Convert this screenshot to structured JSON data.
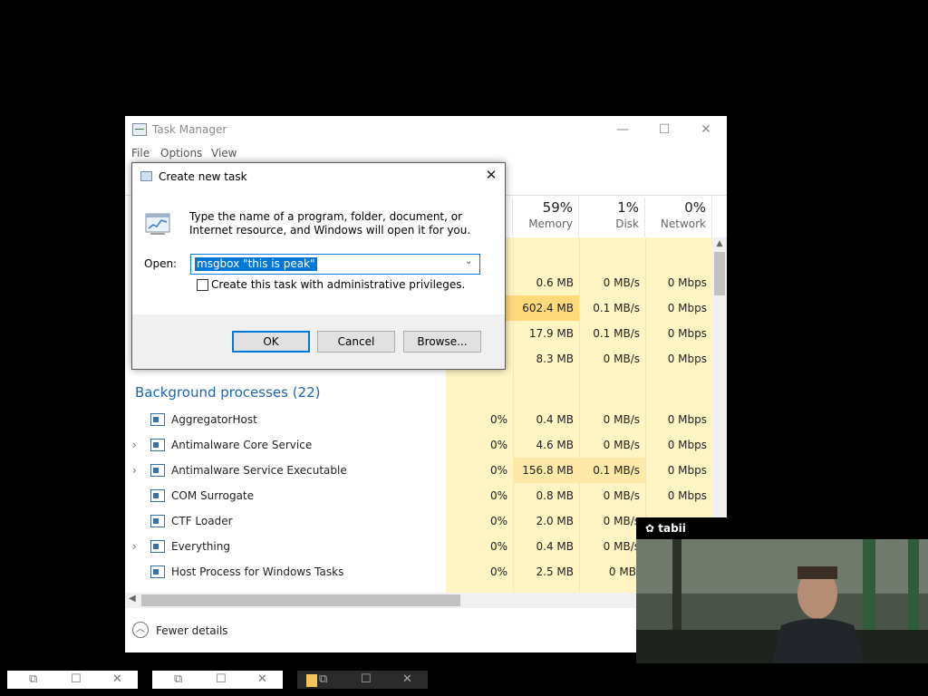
{
  "task_manager": {
    "title": "Task Manager",
    "menu": [
      "File",
      "Options",
      "View"
    ],
    "columns": [
      {
        "pct": "59%",
        "label": "Memory"
      },
      {
        "pct": "1%",
        "label": "Disk"
      },
      {
        "pct": "0%",
        "label": "Network"
      }
    ],
    "app_rows": [
      {
        "memory": "0.6 MB",
        "disk": "0 MB/s",
        "network": "0 Mbps"
      },
      {
        "memory": "602.4 MB",
        "disk": "0.1 MB/s",
        "network": "0 Mbps"
      },
      {
        "memory": "17.9 MB",
        "disk": "0.1 MB/s",
        "network": "0 Mbps"
      },
      {
        "memory": "8.3 MB",
        "disk": "0 MB/s",
        "network": "0 Mbps"
      }
    ],
    "background_title": "Background processes (22)",
    "processes": [
      {
        "name": "AggregatorHost",
        "cpu": "0%",
        "memory": "0.4 MB",
        "disk": "0 MB/s",
        "network": "0 Mbps",
        "expandable": false
      },
      {
        "name": "Antimalware Core Service",
        "cpu": "0%",
        "memory": "4.6 MB",
        "disk": "0 MB/s",
        "network": "0 Mbps",
        "expandable": true
      },
      {
        "name": "Antimalware Service Executable",
        "cpu": "0%",
        "memory": "156.8 MB",
        "disk": "0.1 MB/s",
        "network": "0 Mbps",
        "expandable": true
      },
      {
        "name": "COM Surrogate",
        "cpu": "0%",
        "memory": "0.8 MB",
        "disk": "0 MB/s",
        "network": "0 Mbps",
        "expandable": false
      },
      {
        "name": "CTF Loader",
        "cpu": "0%",
        "memory": "2.0 MB",
        "disk": "0 MB/s",
        "network": "",
        "expandable": false
      },
      {
        "name": "Everything",
        "cpu": "0%",
        "memory": "0.4 MB",
        "disk": "0 MB/s",
        "network": "",
        "expandable": true
      },
      {
        "name": "Host Process for Windows Tasks",
        "cpu": "0%",
        "memory": "2.5 MB",
        "disk": "0 MB/",
        "network": "",
        "expandable": false
      }
    ],
    "fewer_details": "Fewer details"
  },
  "dialog": {
    "title": "Create new task",
    "description": "Type the name of a program, folder, document, or Internet resource, and Windows will open it for you.",
    "open_label": "Open:",
    "open_value": "msgbox \"this is peak\"",
    "admin_checkbox_label": "Create this task with administrative privileges.",
    "admin_checked": false,
    "ok": "OK",
    "cancel": "Cancel",
    "browse": "Browse..."
  },
  "video": {
    "brand": "tabii"
  },
  "colors": {
    "accent": "#0078d7",
    "group_title": "#1e64b4",
    "heat_light": "#fff4c4",
    "heat_mid": "#ffe9a8",
    "heat_high": "#ffd97a"
  }
}
